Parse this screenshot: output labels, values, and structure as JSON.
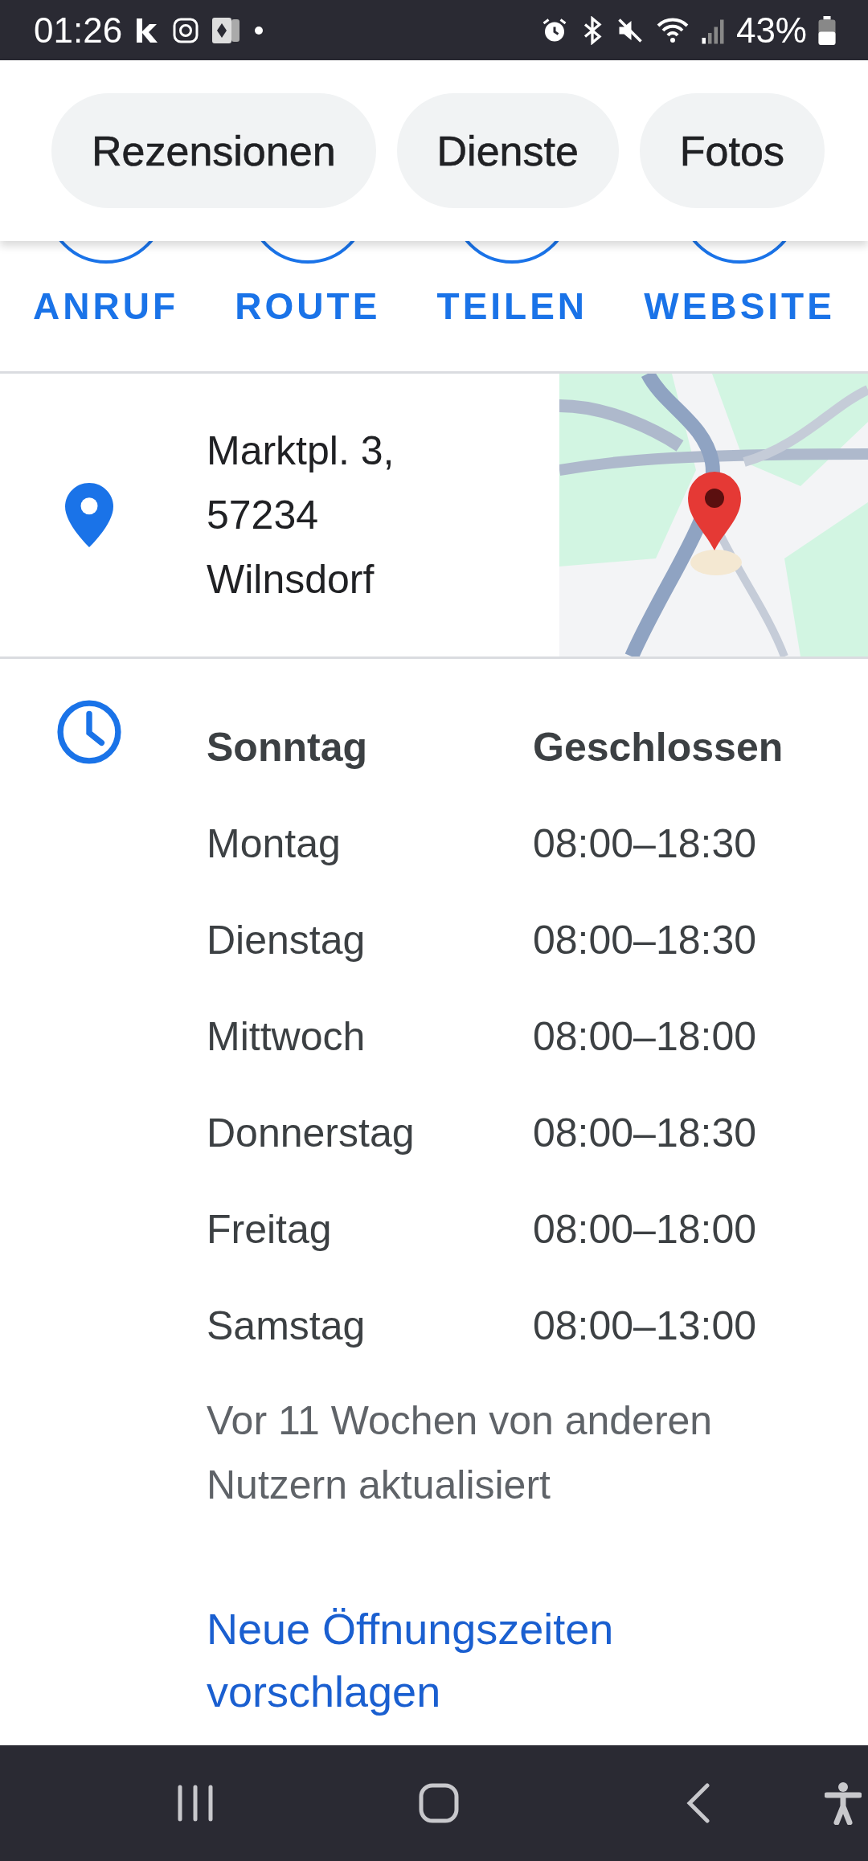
{
  "status_bar": {
    "time": "01:26",
    "battery": "43%"
  },
  "chips": [
    {
      "label": "Rezensionen"
    },
    {
      "label": "Dienste"
    },
    {
      "label": "Fotos"
    }
  ],
  "actions": [
    {
      "label": "ANRUF"
    },
    {
      "label": "ROUTE"
    },
    {
      "label": "TEILEN"
    },
    {
      "label": "WEBSITE"
    }
  ],
  "address": {
    "lines": [
      "Marktpl. 3,",
      "57234",
      "Wilnsdorf"
    ]
  },
  "hours": {
    "rows": [
      {
        "day": "Sonntag",
        "time": "Geschlossen",
        "today": true
      },
      {
        "day": "Montag",
        "time": "08:00–18:30",
        "today": false
      },
      {
        "day": "Dienstag",
        "time": "08:00–18:30",
        "today": false
      },
      {
        "day": "Mittwoch",
        "time": "08:00–18:00",
        "today": false
      },
      {
        "day": "Donnerstag",
        "time": "08:00–18:30",
        "today": false
      },
      {
        "day": "Freitag",
        "time": "08:00–18:00",
        "today": false
      },
      {
        "day": "Samstag",
        "time": "08:00–13:00",
        "today": false
      }
    ],
    "note": "Vor 11 Wochen von anderen Nutzern aktualisiert",
    "link": "Neue Öffnungszeiten vorschlagen"
  }
}
